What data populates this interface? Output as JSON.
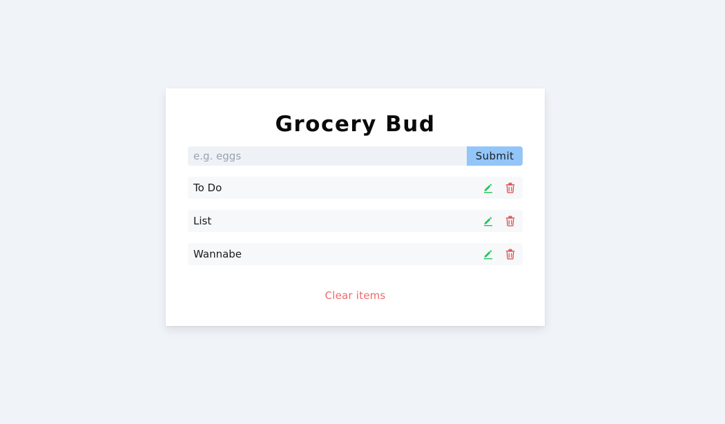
{
  "app": {
    "title": "Grocery Bud"
  },
  "form": {
    "input_value": "",
    "input_placeholder": "e.g. eggs",
    "submit_label": "Submit"
  },
  "items": [
    {
      "label": "To Do"
    },
    {
      "label": "List"
    },
    {
      "label": "Wannabe"
    }
  ],
  "icons": {
    "edit": "pencil-icon",
    "delete": "trash-icon"
  },
  "footer": {
    "clear_label": "Clear items"
  },
  "colors": {
    "background": "#f0f3f8",
    "submit": "#94c5f8",
    "edit": "#22c55e",
    "delete": "#dc4a4a",
    "clear": "#ee6a6a"
  }
}
